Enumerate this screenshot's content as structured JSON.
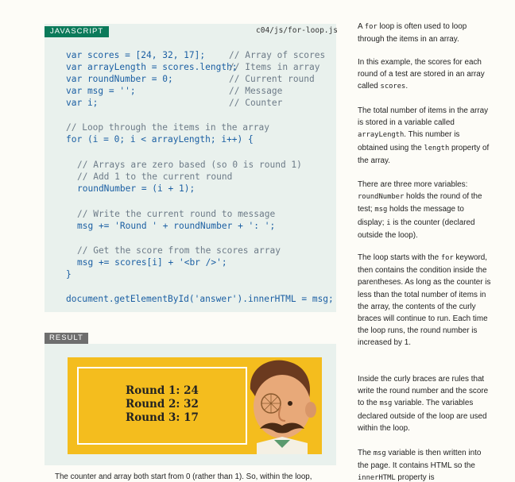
{
  "code_block": {
    "label": "JAVASCRIPT",
    "filename": "c04/js/for-loop.js",
    "lines": [
      {
        "text": "var scores = [24, 32, 17];"
      },
      {
        "text": "var arrayLength = scores.length;"
      },
      {
        "text": "var roundNumber = 0;"
      },
      {
        "text": "var msg = '';"
      },
      {
        "text": "var i;"
      },
      {
        "text": "// Loop through the items in the array"
      },
      {
        "text": "for (i = 0; i < arrayLength; i++) {"
      },
      {
        "text": "// Arrays are zero based (so 0 is round 1)"
      },
      {
        "text": "// Add 1 to the current round"
      },
      {
        "text": "roundNumber = (i + 1);"
      },
      {
        "text": "// Write the current round to message"
      },
      {
        "text": "msg += 'Round ' + roundNumber + ': ';"
      },
      {
        "text": "// Get the score from the scores array"
      },
      {
        "text": "msg += scores[i] + '<br />';"
      },
      {
        "text": "}"
      },
      {
        "text": "document.getElementById('answer').innerHTML = msg;"
      }
    ],
    "inline_comments": [
      "// Array of scores",
      "// Items in array",
      "// Current round",
      "// Message",
      "// Counter"
    ]
  },
  "result_block": {
    "label": "RESULT",
    "rounds": [
      "Round 1: 24",
      "Round 2: 32",
      "Round 3: 17"
    ]
  },
  "caption": "The counter and array both start from 0 (rather than 1). So, within the loop,",
  "sidebar": {
    "p1": {
      "a": "A ",
      "b": "for",
      "c": " loop is often used to loop through the items in an array."
    },
    "p2": {
      "a": "In this example, the scores for each round of a test are stored in an array called ",
      "b": "scores",
      "c": "."
    },
    "p3": {
      "a": "The total number of items in the array is stored in a variable called ",
      "b": "arrayLength",
      "c": ". This number is obtained using the ",
      "d": "length",
      "e": " property of the array."
    },
    "p4": {
      "a": "There are three more variables: ",
      "b": "roundNumber",
      "c": " holds the round of the test; ",
      "d": "msg",
      "e": " holds the message to display; ",
      "f": "i",
      "g": " is the counter (declared outside the loop)."
    },
    "p5": {
      "a": "The loop starts with the ",
      "b": "for",
      "c": " keyword, then contains the condition inside the parentheses. As long as the counter is less than the total number of items in the array, the contents of the curly braces will continue to run. Each time the loop runs, the round number is increased by 1."
    },
    "p6": {
      "a": "Inside the curly braces are rules that write the round number and the score to the ",
      "b": "msg",
      "c": " variable. The variables declared outside of the loop are used within the loop."
    },
    "p7": {
      "a": "The ",
      "b": "msg",
      "c": " variable is then written into the page. It contains HTML so the ",
      "d": "innerHTML",
      "e": " property is"
    }
  },
  "colors": {
    "code_keyword": "#1b5fa3",
    "code_comment": "#6d7b88",
    "label_js": "#0b7a5a",
    "label_result": "#6e6e6e",
    "panel_bg": "#e9f1ed",
    "poster_bg": "#f4bd1e"
  },
  "icons": {
    "poster_character": "mustached-man-illustration"
  }
}
